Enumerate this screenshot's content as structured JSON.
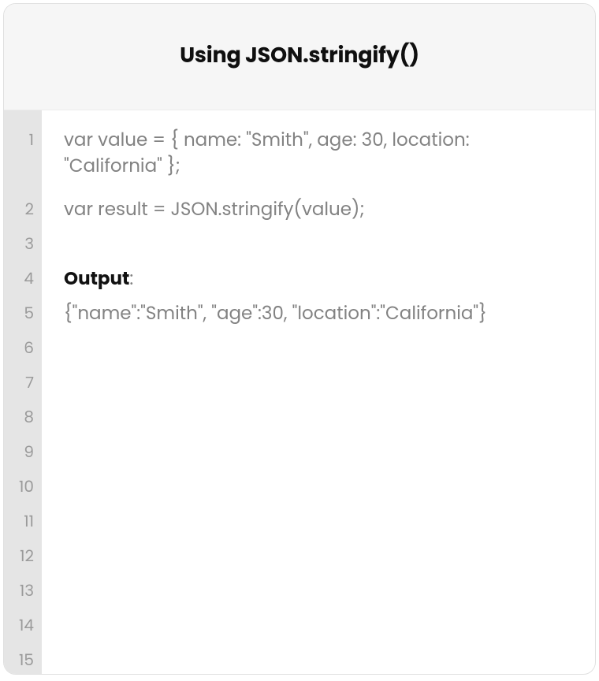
{
  "header": {
    "title": "Using JSON.stringify()"
  },
  "code": {
    "line1": "var value = { name: \"Smith\", age: 30, location: \"California\" };",
    "line2": "var result = JSON.stringify(value);",
    "output_label": "Output",
    "output_colon": ":",
    "output_value": "{\"name\":\"Smith\", \"age\":30, \"location\":\"California\"}"
  },
  "gutter": {
    "lines": [
      "1",
      "2",
      "3",
      "4",
      "5",
      "6",
      "7",
      "8",
      "9",
      "10",
      "11",
      "12",
      "13",
      "14",
      "15"
    ]
  }
}
